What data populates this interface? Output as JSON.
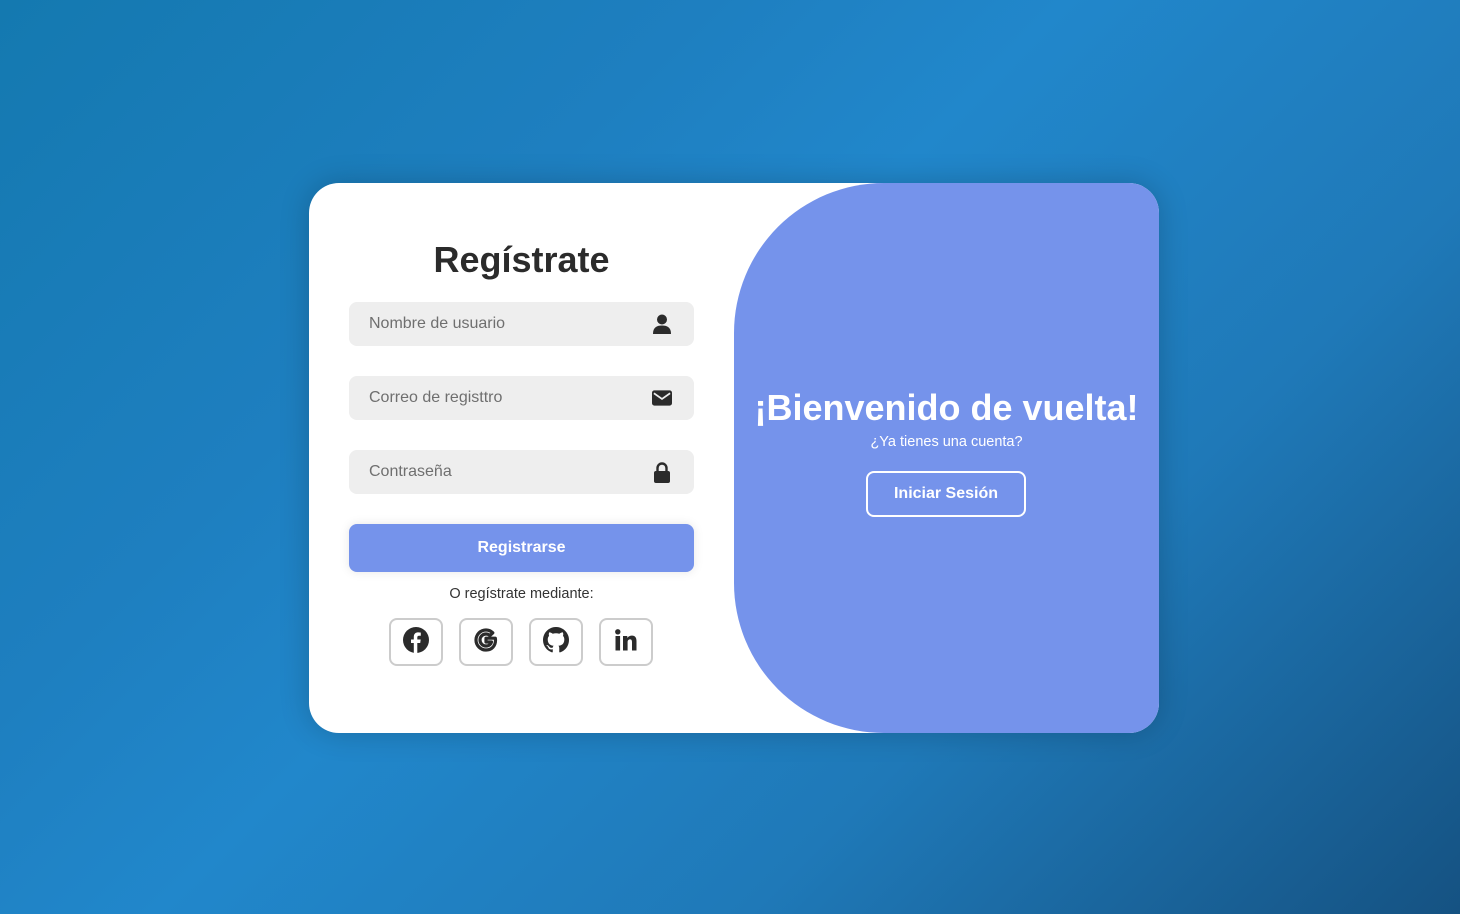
{
  "register": {
    "title": "Regístrate",
    "username_placeholder": "Nombre de usuario",
    "email_placeholder": "Correo de registtro",
    "password_placeholder": "Contraseña",
    "submit_label": "Registrarse",
    "social_text": "O regístrate mediante:",
    "social_icons": [
      "facebook-icon",
      "google-icon",
      "github-icon",
      "linkedin-icon"
    ]
  },
  "welcome": {
    "title": "¡Bienvenido de vuelta!",
    "subtitle": "¿Ya tienes una cuenta?",
    "login_label": "Iniciar Sesión"
  },
  "colors": {
    "accent": "#7593eb",
    "input_bg": "#eeeeee",
    "text_dark": "#333333",
    "background_start": "#1479b0",
    "background_end": "#155282"
  }
}
